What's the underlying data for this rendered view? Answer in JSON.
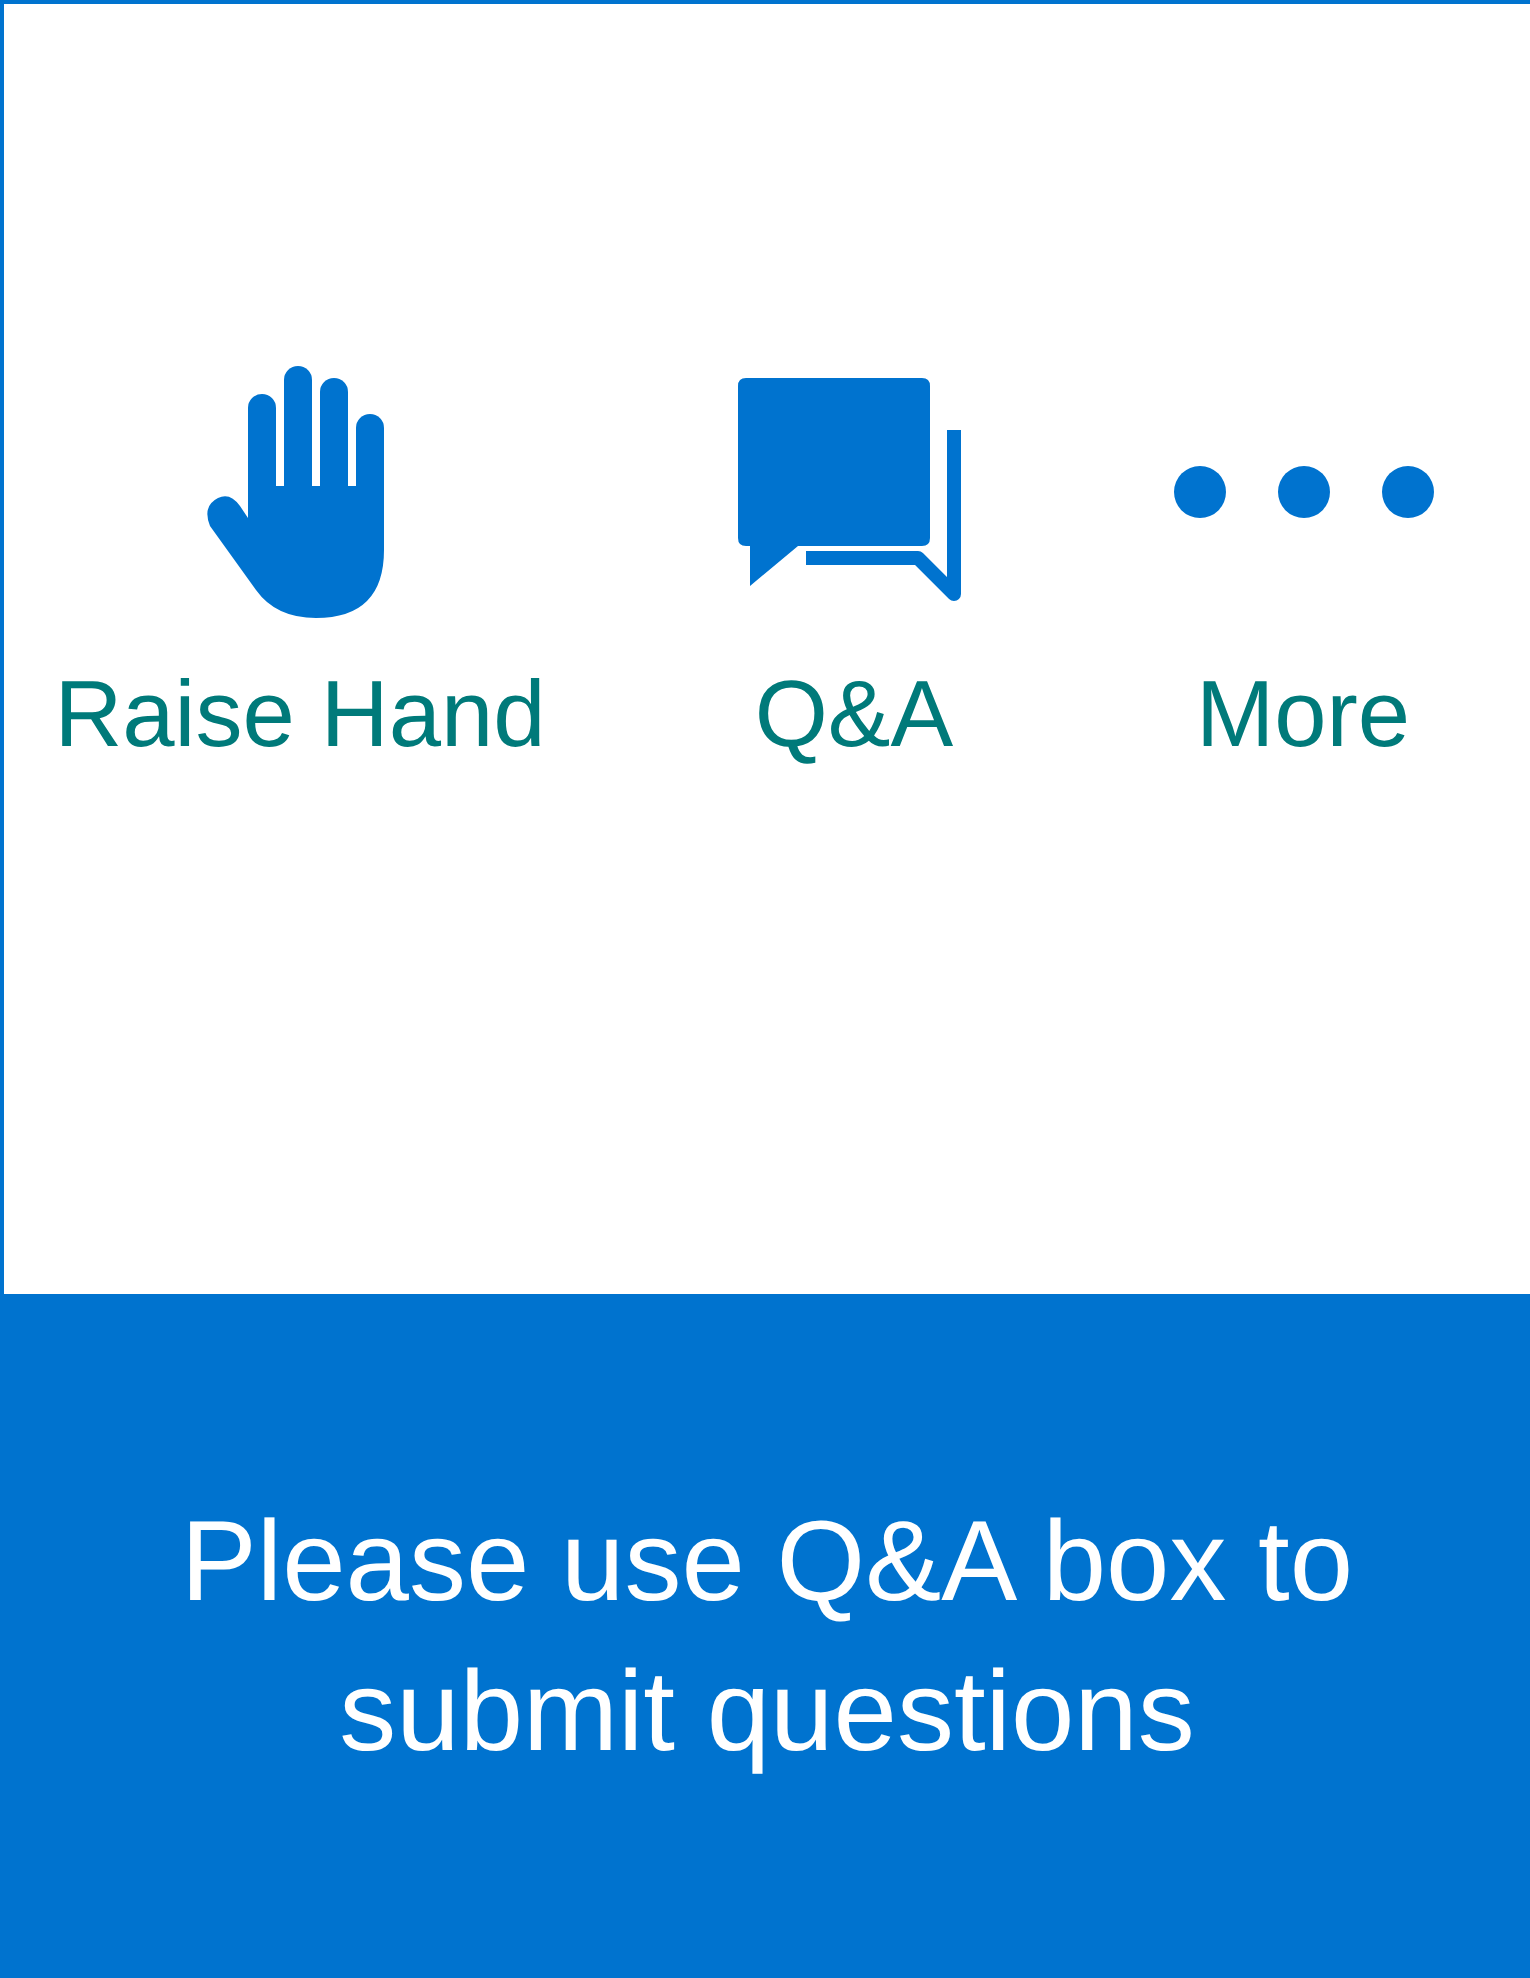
{
  "actions": [
    {
      "label": "Raise Hand",
      "kind": "hand"
    },
    {
      "label": "Q&A",
      "kind": "qa"
    },
    {
      "label": "More",
      "kind": "more"
    }
  ],
  "banner": {
    "text": "Please use Q&A box to submit questions"
  }
}
